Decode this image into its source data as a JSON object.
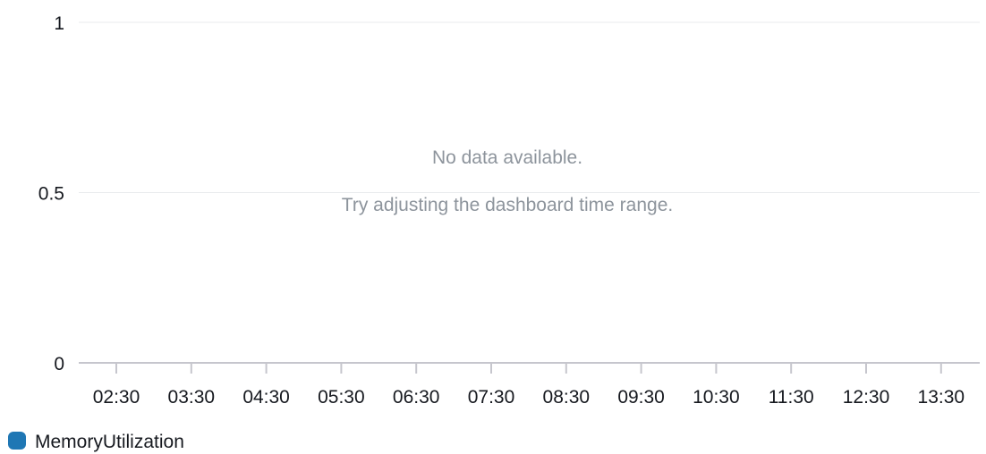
{
  "chart_data": {
    "type": "line",
    "title": "",
    "xlabel": "",
    "ylabel": "",
    "ylim": [
      0,
      1
    ],
    "y_ticks": [
      "1",
      "0.5",
      "0"
    ],
    "x_ticks": [
      "02:30",
      "03:30",
      "04:30",
      "05:30",
      "06:30",
      "07:30",
      "08:30",
      "09:30",
      "10:30",
      "11:30",
      "12:30",
      "13:30"
    ],
    "series": [
      {
        "name": "MemoryUtilization",
        "values": [],
        "color": "#1f77b4"
      }
    ],
    "grid": "horizontal",
    "legend_position": "bottom-left"
  },
  "empty_state": {
    "title": "No data available.",
    "hint": "Try adjusting the dashboard time range."
  },
  "colors": {
    "gridline": "#e9ebed",
    "axis": "#c6c6cd",
    "tick_text": "#16191f",
    "message_text": "#8d949c"
  }
}
